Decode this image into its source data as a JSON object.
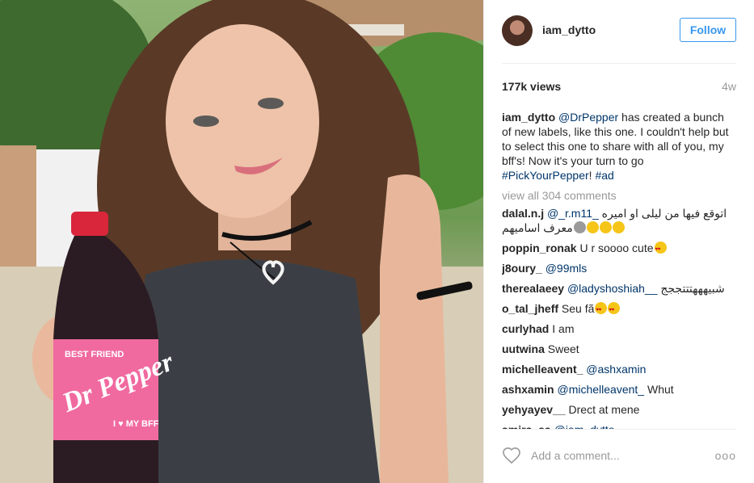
{
  "post": {
    "username": "iam_dytto",
    "follow_label": "Follow",
    "views": "177k views",
    "age": "4w",
    "caption": {
      "username": "iam_dytto",
      "mention": "@DrPepper",
      "text1": " has created a bunch of new labels, like this one. I couldn't help but to select this one to share with all of you, my bff's! Now it's your turn to go ",
      "tag1": "#PickYourPepper",
      "sep": "! ",
      "tag2": "#ad"
    },
    "view_all": "view all 304 comments",
    "add_comment_placeholder": "Add a comment...",
    "more_label": "ooo"
  },
  "photo": {
    "bottle_brand": "Dr Pepper",
    "bottle_sub": "BEST FRIEND",
    "bottle_bff": "I ♥ MY BFF"
  },
  "comments": [
    {
      "user": "dalal.n.j",
      "mention": "@_r.m11_",
      "text": "اتوقع فيها من ليلى او اميره معرف اساميهم",
      "emoji": [
        "skull",
        "joy",
        "joy",
        "joy"
      ]
    },
    {
      "user": "poppin_ronak",
      "mention": "",
      "text": "U r soooo cute",
      "emoji": [
        "heart"
      ]
    },
    {
      "user": "j8oury_",
      "mention": "@99mls",
      "text": "",
      "emoji": []
    },
    {
      "user": "therealaeey",
      "mention": "@ladyshoshiah__",
      "text": "شبيهههتتتججج",
      "emoji": []
    },
    {
      "user": "o_tal_jheff",
      "mention": "",
      "text": "Seu fã",
      "emoji": [
        "heart",
        "heart"
      ]
    },
    {
      "user": "curlyhad",
      "mention": "",
      "text": "I am",
      "emoji": []
    },
    {
      "user": "uutwina",
      "mention": "",
      "text": "Sweet",
      "emoji": []
    },
    {
      "user": "michelleavent_",
      "mention": "@ashxamin",
      "text": "",
      "emoji": []
    },
    {
      "user": "ashxamin",
      "mention": "@michelleavent_",
      "text": "Whut",
      "emoji": []
    },
    {
      "user": "yehyayev__",
      "mention": "",
      "text": "Drect at mene",
      "emoji": []
    },
    {
      "user": "amira_sa",
      "mention": "@iam_dytto",
      "text": "",
      "emoji": []
    }
  ],
  "colors": {
    "accent": "#3897f0",
    "link": "#003569",
    "muted": "#999999"
  }
}
